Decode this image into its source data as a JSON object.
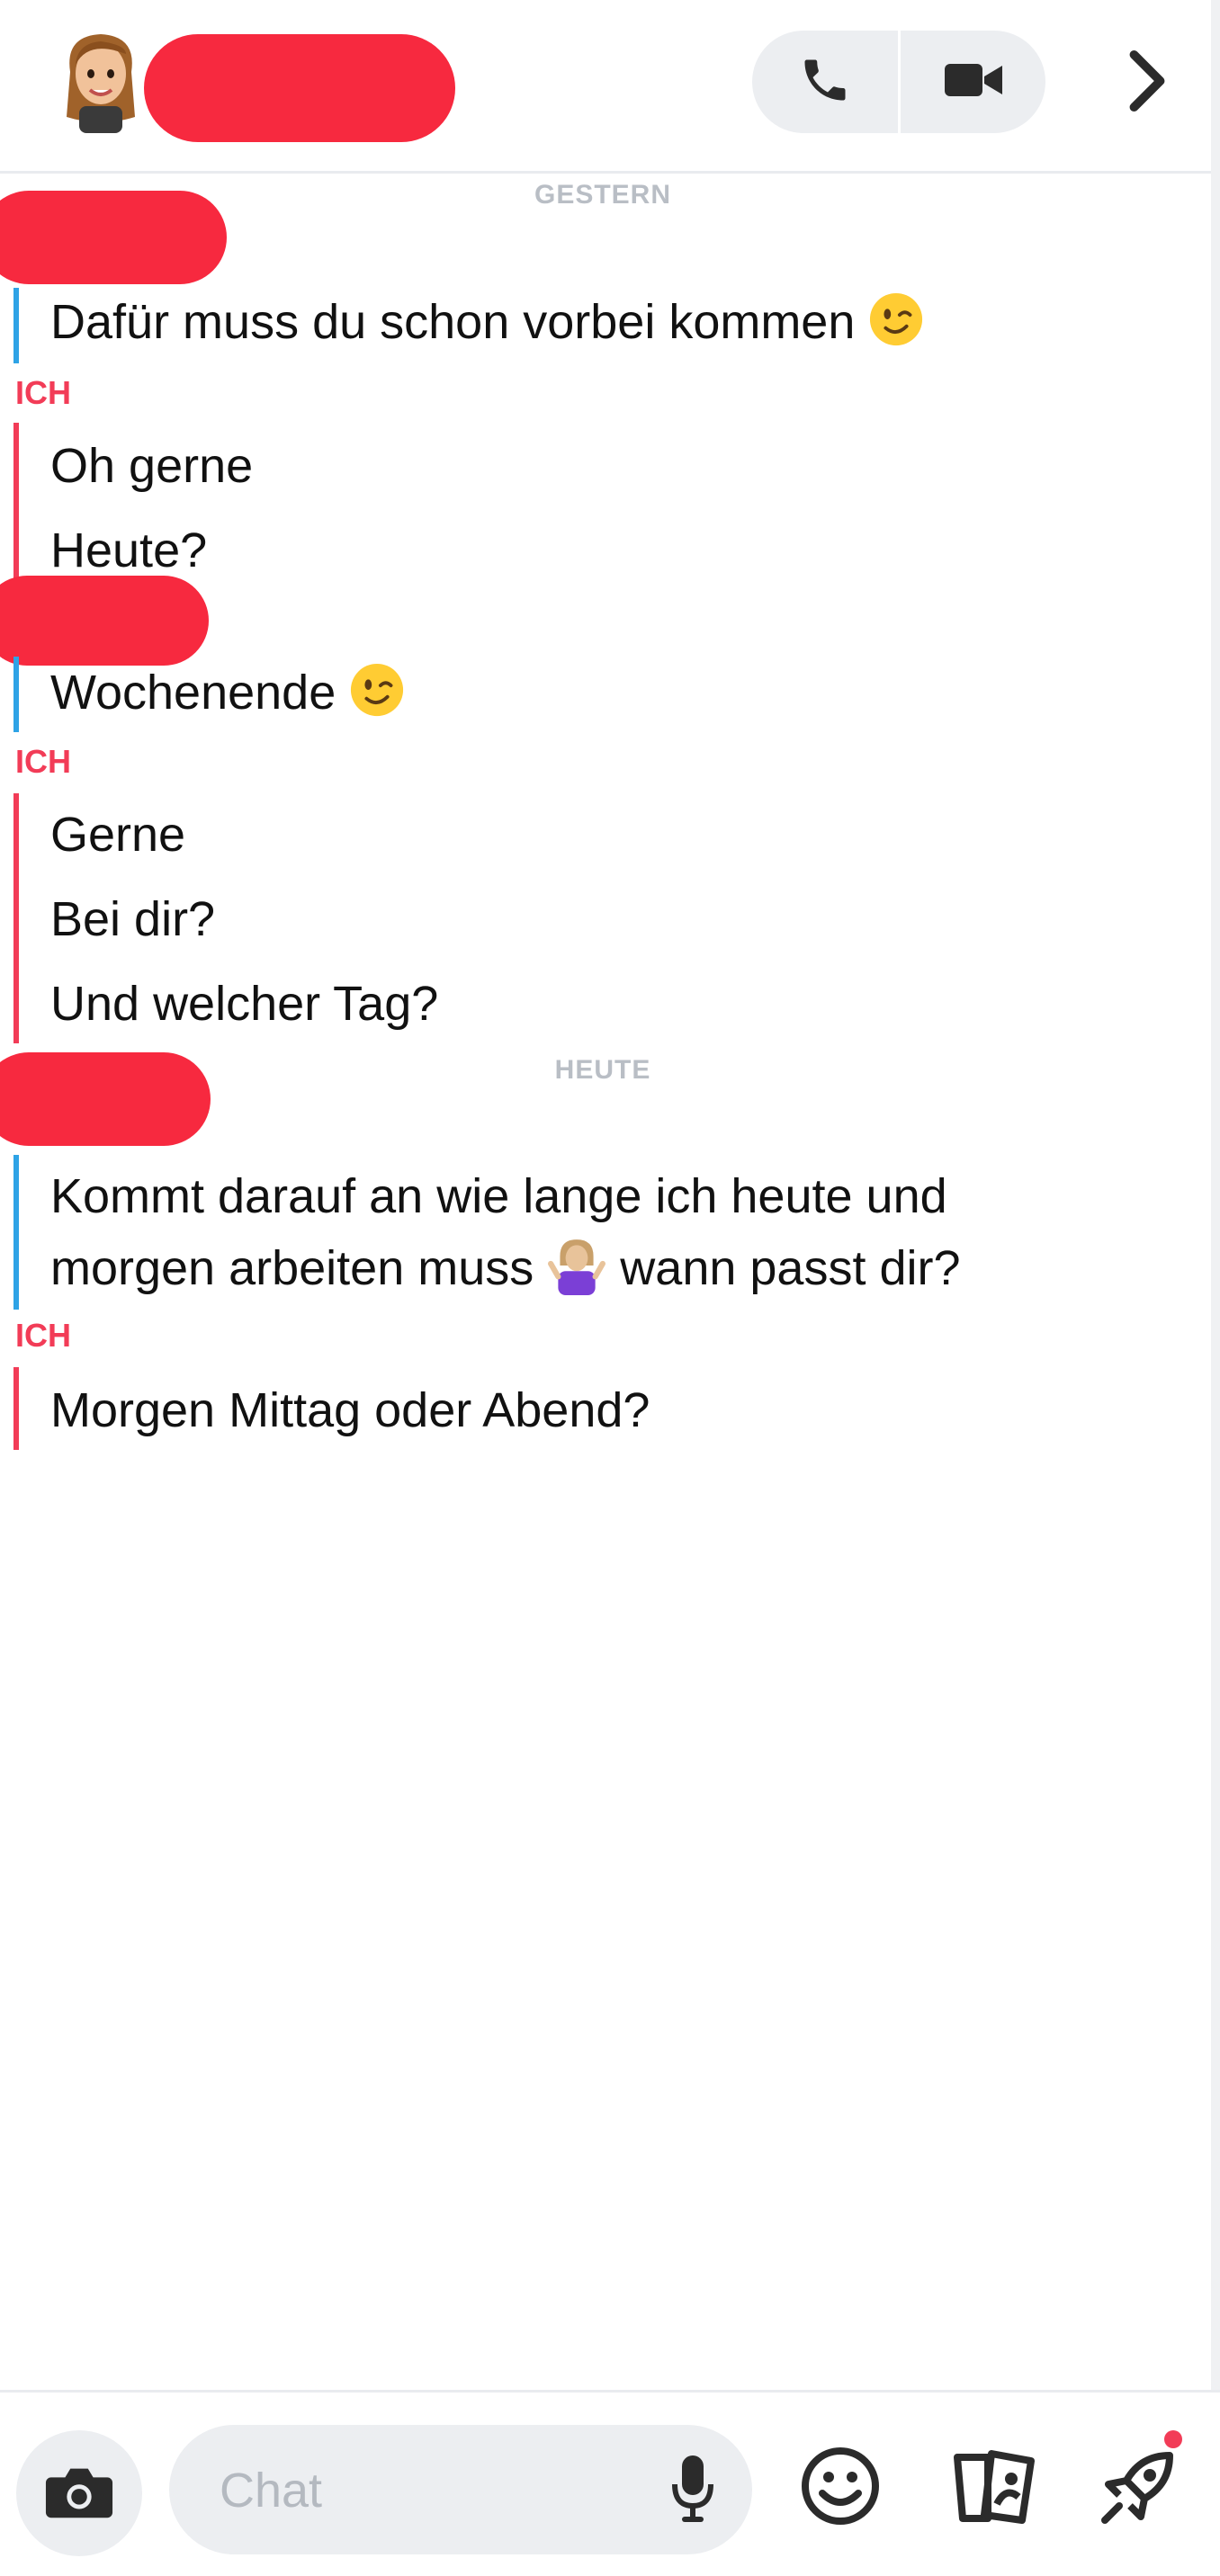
{
  "header": {
    "call_icon": "phone-icon",
    "video_icon": "video-camera-icon",
    "next_icon": "chevron-right-icon"
  },
  "conversation": {
    "separators": {
      "yesterday": "GESTERN",
      "today": "HEUTE"
    },
    "me_label": "ICH",
    "messages": [
      {
        "text": "Dafür muss du schon vorbei kommen",
        "emoji": "😉"
      },
      {
        "text": "Oh gerne"
      },
      {
        "text": "Heute?"
      },
      {
        "text": "Wochenende",
        "emoji": "😉"
      },
      {
        "text": "Gerne"
      },
      {
        "text": "Bei dir?"
      },
      {
        "text": "Und welcher Tag?"
      },
      {
        "line1": "Kommt darauf an wie lange ich heute und",
        "line2a": "morgen arbeiten muss",
        "line2b": "wann passt dir?"
      },
      {
        "text": "Morgen Mittag oder Abend?"
      }
    ]
  },
  "footer": {
    "chat_placeholder": "Chat",
    "camera_icon": "camera-icon",
    "mic_icon": "microphone-icon",
    "emoji_icon": "smiley-icon",
    "cards_icon": "cards-icon",
    "games_icon": "rocket-icon"
  },
  "colors": {
    "me": "#f23c57",
    "friend": "#2ea3e6",
    "redaction": "#f7293f",
    "separator": "#b9bec5"
  }
}
